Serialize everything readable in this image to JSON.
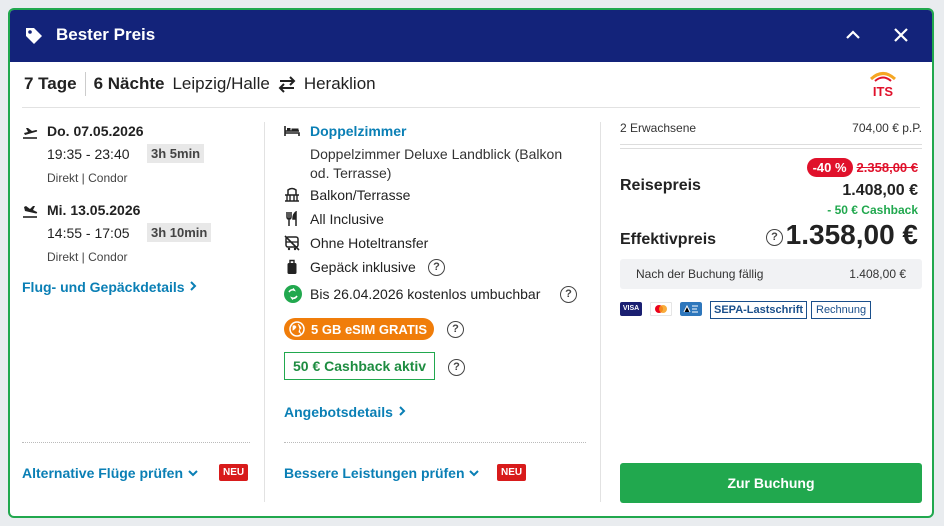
{
  "header": {
    "title": "Bester Preis"
  },
  "route": {
    "days": "7 Tage",
    "nights": "6 Nächte",
    "origin": "Leipzig/Halle",
    "destination": "Heraklion",
    "operator_logo": "ITS"
  },
  "outbound": {
    "date": "Do. 07.05.2026",
    "time": "19:35 - 23:40",
    "duration": "3h 5min",
    "type": "Direkt",
    "airline": "Condor"
  },
  "inbound": {
    "date": "Mi. 13.05.2026",
    "time": "14:55 - 17:05",
    "duration": "3h 10min",
    "type": "Direkt",
    "airline": "Condor"
  },
  "links": {
    "flight_details": "Flug- und Gepäckdetails",
    "alt_flights": "Alternative Flüge prüfen",
    "offer_details": "Angebotsdetails",
    "better_services": "Bessere Leistungen prüfen",
    "new_badge": "NEU"
  },
  "room": {
    "type": "Doppelzimmer",
    "description_line1": "Doppelzimmer Deluxe Landblick (Balkon",
    "description_line2": "od. Terrasse)",
    "balcony": "Balkon/Terrasse",
    "board": "All Inclusive",
    "transfer": "Ohne Hoteltransfer",
    "luggage": "Gepäck inklusive",
    "rebook": "Bis 26.04.2026 kostenlos umbuchbar",
    "esim": "5 GB eSIM GRATIS",
    "cashback": "50 € Cashback aktiv"
  },
  "price": {
    "travellers": "2 Erwachsene",
    "per_person": "704,00 € p.P.",
    "label_travel": "Reisepreis",
    "discount": "-40 %",
    "old_price": "2.358,00 €",
    "travel_price": "1.408,00 €",
    "cashback": "- 50 € Cashback",
    "label_effective": "Effektivpreis",
    "effective_price": "1.358,00 €",
    "due_label": "Nach der Buchung fällig",
    "due_amount": "1.408,00 €",
    "payment_methods": [
      "VISA",
      "Mastercard",
      "AMEX",
      "SEPA-Lastschrift",
      "Rechnung"
    ],
    "book_button": "Zur Buchung"
  },
  "colors": {
    "header_bg": "#13237a",
    "accent_green": "#21a84e",
    "link_blue": "#0a7fb5",
    "discount_red": "#e0112b",
    "esim_orange": "#f07d0a"
  }
}
